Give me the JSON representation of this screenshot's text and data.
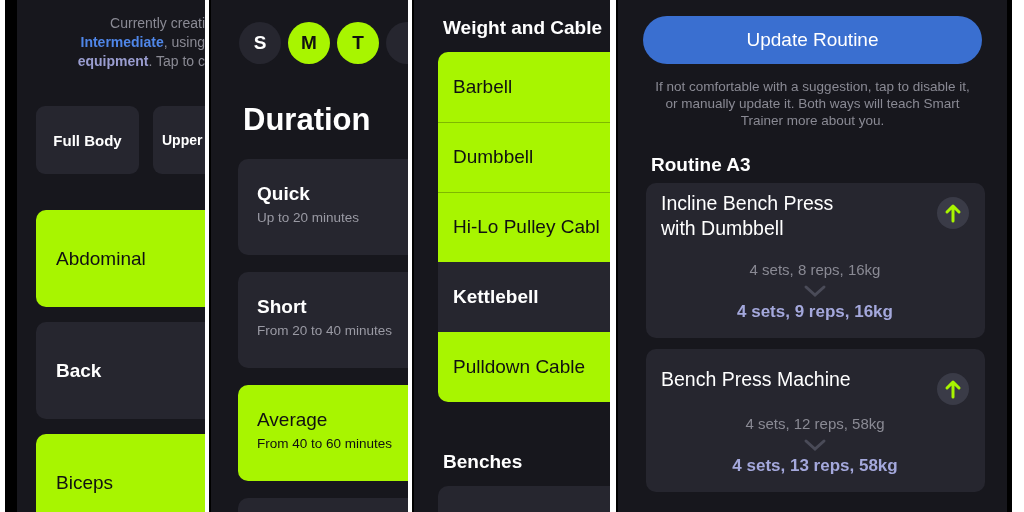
{
  "split_screen": {
    "intro_lines": [
      [
        {
          "kind": "plain",
          "text": "Currently creati"
        }
      ],
      [
        {
          "kind": "level",
          "text": "Intermediate"
        },
        {
          "kind": "plain",
          "text": ", using"
        }
      ],
      [
        {
          "kind": "equipment",
          "text": "equipment"
        },
        {
          "kind": "plain",
          "text": ". Tap to c"
        }
      ]
    ],
    "splits": [
      {
        "label": "Full Body"
      },
      {
        "label": "Upper"
      }
    ],
    "muscles": [
      {
        "label": "Abdominal",
        "selected": true
      },
      {
        "label": "Back",
        "selected": false
      },
      {
        "label": "Biceps",
        "selected": true
      }
    ]
  },
  "schedule_screen": {
    "days": [
      {
        "label": "S",
        "selected": false
      },
      {
        "label": "M",
        "selected": true
      },
      {
        "label": "T",
        "selected": true
      },
      {
        "selected": false
      }
    ],
    "title": "Duration",
    "durations": [
      {
        "name": "Quick",
        "range": "Up to 20 minutes",
        "selected": false
      },
      {
        "name": "Short",
        "range": "From 20 to 40 minutes",
        "selected": false
      },
      {
        "name": "Average",
        "range": "From 40 to 60 minutes",
        "selected": true
      },
      {
        "selected": false
      }
    ]
  },
  "equipment_screen": {
    "sections": [
      {
        "title": "Weight and Cable",
        "items": [
          {
            "label": "Barbell",
            "selected": true
          },
          {
            "label": "Dumbbell",
            "selected": true
          },
          {
            "label": "Hi-Lo Pulley Cabl",
            "selected": true
          },
          {
            "label": "Kettlebell",
            "selected": false
          },
          {
            "label": "Pulldown Cable",
            "selected": true
          }
        ]
      },
      {
        "title": "Benches",
        "items": [
          {
            "selected": false
          }
        ]
      }
    ]
  },
  "routine_screen": {
    "button": "Update Routine",
    "note": "If not comfortable with a suggestion, tap to disable it, or manually update it. Both ways will teach Smart Trainer more about you.",
    "routine_title": "Routine A3",
    "exercises": [
      {
        "name": "Incline Bench Press with Dumbbell",
        "current": "4 sets, 8 reps, 16kg",
        "suggested": "4 sets, 9 reps, 16kg"
      },
      {
        "name": "Bench Press Machine",
        "current": "4 sets, 12 reps, 58kg",
        "suggested": "4 sets, 13 reps, 58kg"
      }
    ]
  }
}
